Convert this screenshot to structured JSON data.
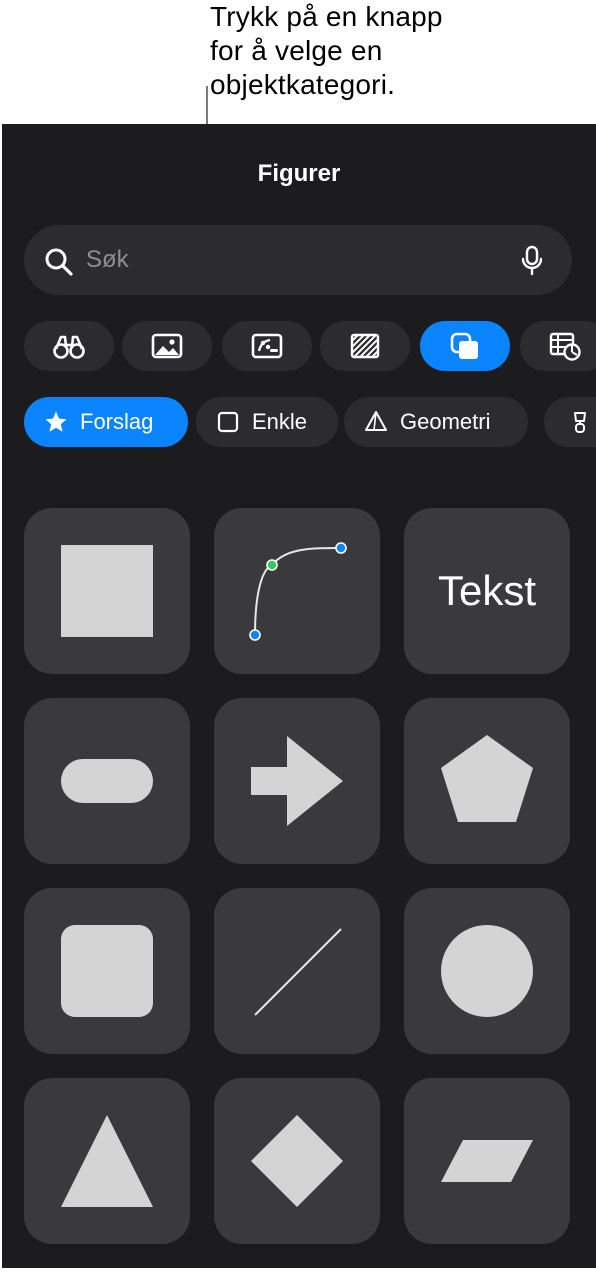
{
  "callout": {
    "lines": [
      "Trykk på en knapp",
      "for å velge en",
      "objektkategori."
    ]
  },
  "panel": {
    "title": "Figurer",
    "search": {
      "placeholder": "Søk",
      "value": ""
    },
    "categories": [
      {
        "icon": "binoculars-icon",
        "active": false
      },
      {
        "icon": "photo-icon",
        "active": false
      },
      {
        "icon": "sticker-icon",
        "active": false
      },
      {
        "icon": "texture-icon",
        "active": false
      },
      {
        "icon": "shapes-icon",
        "active": true
      },
      {
        "icon": "table-chart-icon",
        "active": false
      }
    ],
    "chips": [
      {
        "label": "Forslag",
        "icon": "star-icon",
        "active": true
      },
      {
        "label": "Enkle",
        "icon": "square-outline-icon",
        "active": false
      },
      {
        "label": "Geometri",
        "icon": "pyramid-icon",
        "active": false
      },
      {
        "label": "",
        "icon": "lamp-icon",
        "active": false
      }
    ],
    "shapes": [
      {
        "name": "square"
      },
      {
        "name": "curve"
      },
      {
        "name": "text",
        "label": "Tekst"
      },
      {
        "name": "pill"
      },
      {
        "name": "arrow"
      },
      {
        "name": "pentagon"
      },
      {
        "name": "rounded-square"
      },
      {
        "name": "line"
      },
      {
        "name": "circle"
      },
      {
        "name": "triangle"
      },
      {
        "name": "diamond"
      },
      {
        "name": "parallelogram"
      }
    ],
    "colors": {
      "background": "#1c1c1e",
      "control": "#2c2c2e",
      "tile": "#3a3a3c",
      "accent": "#0a84ff",
      "shape_fill": "#d4d4d4"
    }
  }
}
